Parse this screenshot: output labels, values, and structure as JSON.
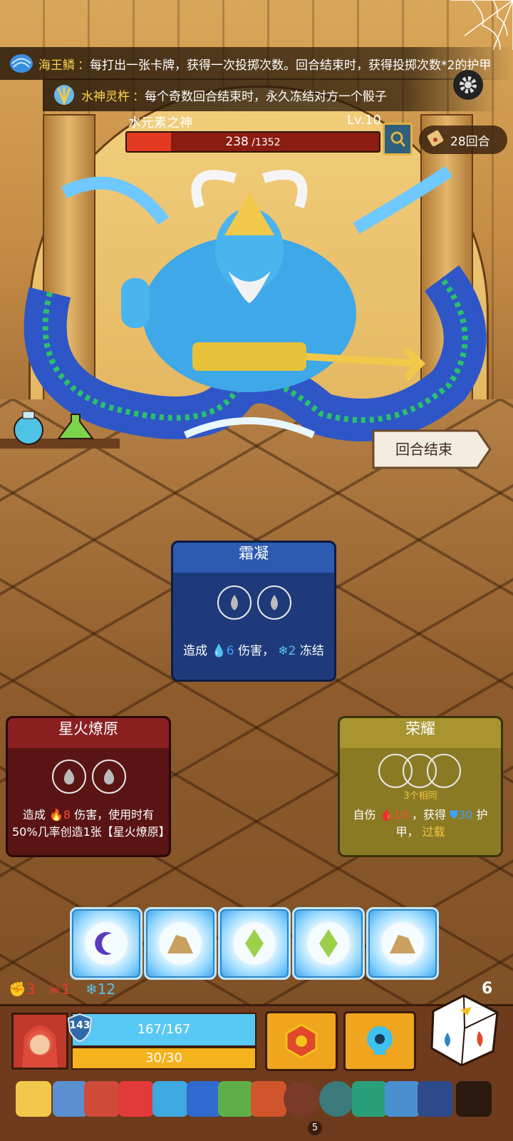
{
  "relics": [
    {
      "name": "海王鳞",
      "desc": "每打出一张卡牌，获得一次投掷次数。回合结束时，获得投掷次数*2的护甲",
      "icon": "scale-icon"
    },
    {
      "name": "水神灵杵",
      "desc": "每个奇数回合结束时，永久冻结对方一个骰子",
      "icon": "trident-icon"
    }
  ],
  "enemy": {
    "name": "水元素之神",
    "level": "Lv.10",
    "hp": "238",
    "hp_max": " /1352",
    "hp_fraction": 0.176
  },
  "rounds": {
    "label": "28回合"
  },
  "end_turn": {
    "label": "回合结束"
  },
  "cards": [
    {
      "title": "霜凝",
      "desc_prefix": "造成",
      "dmg": "6",
      "desc_mid": "伤害，",
      "freeze": "2",
      "desc_suffix": "冻结",
      "slots": 2
    },
    {
      "title": "星火燎原",
      "desc_prefix": "造成",
      "dmg": "8",
      "desc_rest": "伤害，使用时有50%几率创造1张【星火燎原】",
      "slots": 2
    },
    {
      "title": "荣耀",
      "sub": "3个相同",
      "desc_prefix": "自伤",
      "self_dmg": "10",
      "desc_mid": "，获得",
      "armor": "30",
      "desc_suffix": "护甲，",
      "keyword": "过载"
    }
  ],
  "dice": [
    {
      "face": "moon-icon"
    },
    {
      "face": "mountain-icon"
    },
    {
      "face": "diamond-icon"
    },
    {
      "face": "diamond-icon"
    },
    {
      "face": "mountain-icon"
    }
  ],
  "status": {
    "strength": "3",
    "vulnerable": "1",
    "frost": "12"
  },
  "player": {
    "shield": "143",
    "hp": "167/167",
    "energy": "30/30"
  },
  "dice_left": "6",
  "relic_bar_badge": "5"
}
